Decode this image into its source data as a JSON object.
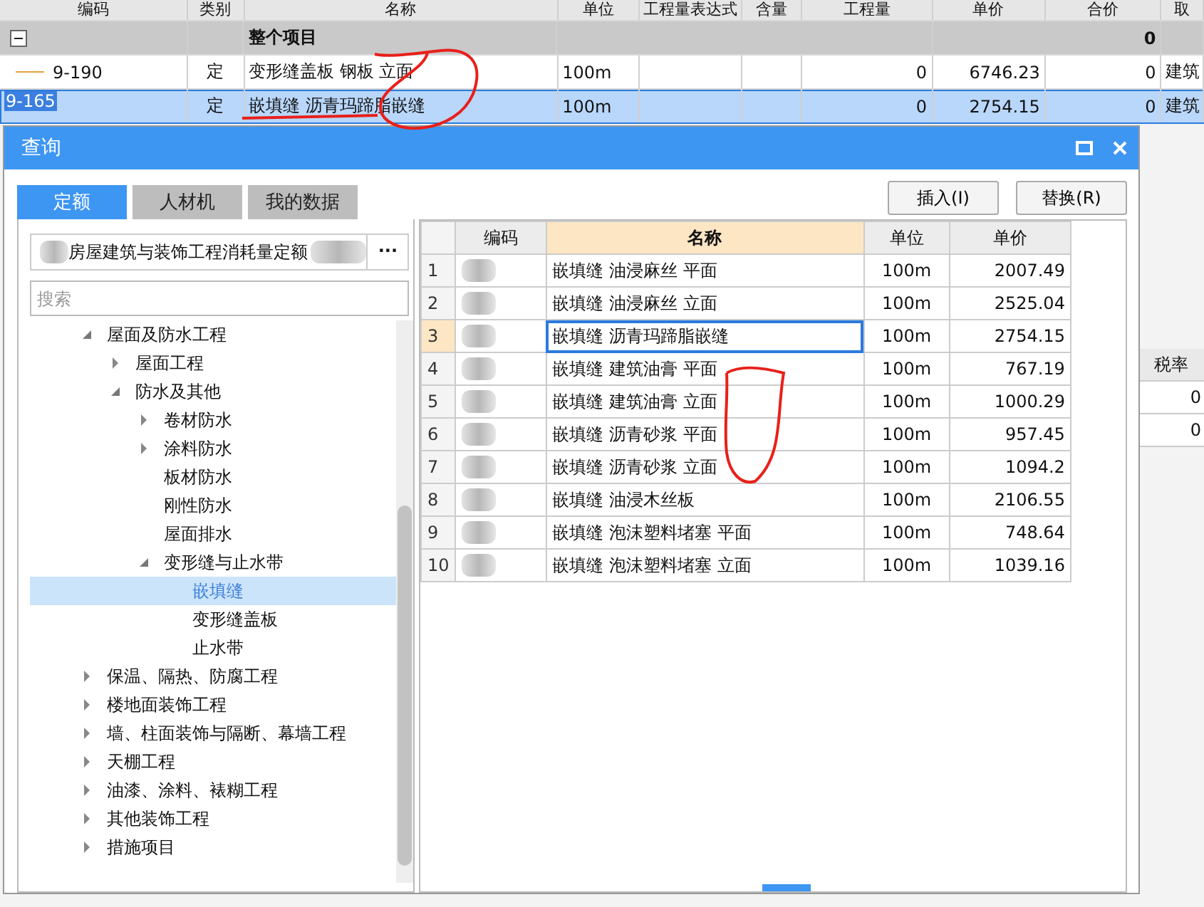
{
  "main_table": {
    "columns": [
      "编码",
      "类别",
      "名称",
      "单位",
      "工程量表达式",
      "含量",
      "工程量",
      "单价",
      "合价",
      "取"
    ],
    "group_row": {
      "label": "整个项目",
      "total": "0",
      "expanded": true
    },
    "rows": [
      {
        "code": "9-190",
        "type": "定",
        "name": "变形缝盖板 钢板 立面",
        "unit": "100m",
        "quantity": "0",
        "price": "6746.23",
        "total": "0",
        "category": "建筑",
        "selected": false
      },
      {
        "code": "9-165",
        "type": "定",
        "name": "嵌填缝 沥青玛蹄脂嵌缝",
        "unit": "100m",
        "quantity": "0",
        "price": "2754.15",
        "total": "0",
        "category": "建筑",
        "selected": true
      }
    ]
  },
  "dialog": {
    "title": "查询",
    "tabs": [
      {
        "label": "定额",
        "selected": true
      },
      {
        "label": "人材机",
        "selected": false
      },
      {
        "label": "我的数据",
        "selected": false
      }
    ],
    "buttons": [
      "插入(I)",
      "替换(R)"
    ],
    "library": {
      "value": "房屋建筑与装饰工程消耗量定额",
      "more": "···"
    },
    "search": {
      "placeholder": "搜索"
    },
    "tree": [
      {
        "label": "屋面及防水工程",
        "kind": "folder",
        "expanded": true,
        "selected": false,
        "children": [
          {
            "label": "屋面工程",
            "kind": "folder",
            "expanded": false,
            "selected": false
          },
          {
            "label": "防水及其他",
            "kind": "folder",
            "expanded": true,
            "selected": false,
            "children": [
              {
                "label": "卷材防水",
                "kind": "folder",
                "expanded": false,
                "selected": false
              },
              {
                "label": "涂料防水",
                "kind": "folder",
                "expanded": false,
                "selected": false
              },
              {
                "label": "板材防水",
                "kind": "leaf",
                "selected": false
              },
              {
                "label": "刚性防水",
                "kind": "leaf",
                "selected": false
              },
              {
                "label": "屋面排水",
                "kind": "leaf",
                "selected": false
              },
              {
                "label": "变形缝与止水带",
                "kind": "folder",
                "expanded": true,
                "selected": false,
                "children": [
                  {
                    "label": "嵌填缝",
                    "kind": "leaf",
                    "selected": true
                  },
                  {
                    "label": "变形缝盖板",
                    "kind": "leaf",
                    "selected": false
                  },
                  {
                    "label": "止水带",
                    "kind": "leaf",
                    "selected": false
                  }
                ]
              }
            ]
          }
        ]
      },
      {
        "label": "保温、隔热、防腐工程",
        "kind": "folder",
        "expanded": false,
        "selected": false
      },
      {
        "label": "楼地面装饰工程",
        "kind": "folder",
        "expanded": false,
        "selected": false
      },
      {
        "label": "墙、柱面装饰与隔断、幕墙工程",
        "kind": "folder",
        "expanded": false,
        "selected": false
      },
      {
        "label": "天棚工程",
        "kind": "folder",
        "expanded": false,
        "selected": false
      },
      {
        "label": "油漆、涂料、裱糊工程",
        "kind": "folder",
        "expanded": false,
        "selected": false
      },
      {
        "label": "其他装饰工程",
        "kind": "folder",
        "expanded": false,
        "selected": false
      },
      {
        "label": "措施项目",
        "kind": "folder",
        "expanded": false,
        "selected": false
      }
    ],
    "results": {
      "columns": [
        "编码",
        "名称",
        "单位",
        "单价"
      ],
      "rows": [
        {
          "index": "1",
          "name": "嵌填缝 油浸麻丝 平面",
          "unit": "100m",
          "price": "2007.49",
          "selected": false
        },
        {
          "index": "2",
          "name": "嵌填缝 油浸麻丝 立面",
          "unit": "100m",
          "price": "2525.04",
          "selected": false
        },
        {
          "index": "3",
          "name": "嵌填缝 沥青玛蹄脂嵌缝",
          "unit": "100m",
          "price": "2754.15",
          "selected": true
        },
        {
          "index": "4",
          "name": "嵌填缝 建筑油膏 平面",
          "unit": "100m",
          "price": "767.19",
          "selected": false
        },
        {
          "index": "5",
          "name": "嵌填缝 建筑油膏 立面",
          "unit": "100m",
          "price": "1000.29",
          "selected": false
        },
        {
          "index": "6",
          "name": "嵌填缝 沥青砂浆 平面",
          "unit": "100m",
          "price": "957.45",
          "selected": false
        },
        {
          "index": "7",
          "name": "嵌填缝 沥青砂浆 立面",
          "unit": "100m",
          "price": "1094.2",
          "selected": false
        },
        {
          "index": "8",
          "name": "嵌填缝 油浸木丝板",
          "unit": "100m",
          "price": "2106.55",
          "selected": false
        },
        {
          "index": "9",
          "name": "嵌填缝 泡沫塑料堵塞 平面",
          "unit": "100m",
          "price": "748.64",
          "selected": false
        },
        {
          "index": "10",
          "name": "嵌填缝 泡沫塑料堵塞 立面",
          "unit": "100m",
          "price": "1039.16",
          "selected": false
        }
      ]
    }
  },
  "background_panel": {
    "column": "税率",
    "rows": [
      "0",
      "0"
    ]
  }
}
